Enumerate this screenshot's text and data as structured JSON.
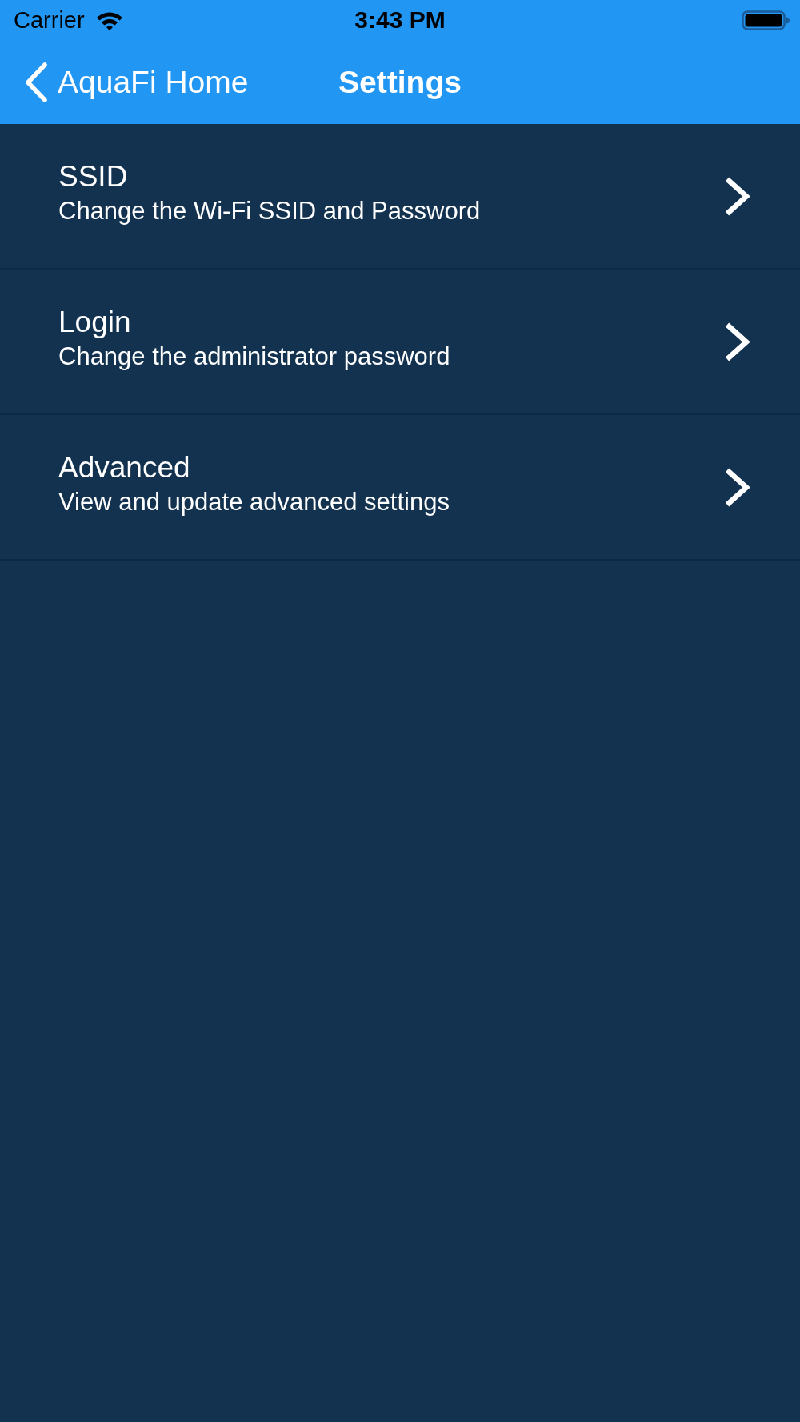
{
  "status_bar": {
    "carrier": "Carrier",
    "time": "3:43 PM"
  },
  "nav_bar": {
    "back_label": "AquaFi Home",
    "title": "Settings"
  },
  "settings_items": [
    {
      "title": "SSID",
      "subtitle": "Change the Wi-Fi SSID and Password"
    },
    {
      "title": "Login",
      "subtitle": "Change the administrator password"
    },
    {
      "title": "Advanced",
      "subtitle": "View and update advanced settings"
    }
  ]
}
